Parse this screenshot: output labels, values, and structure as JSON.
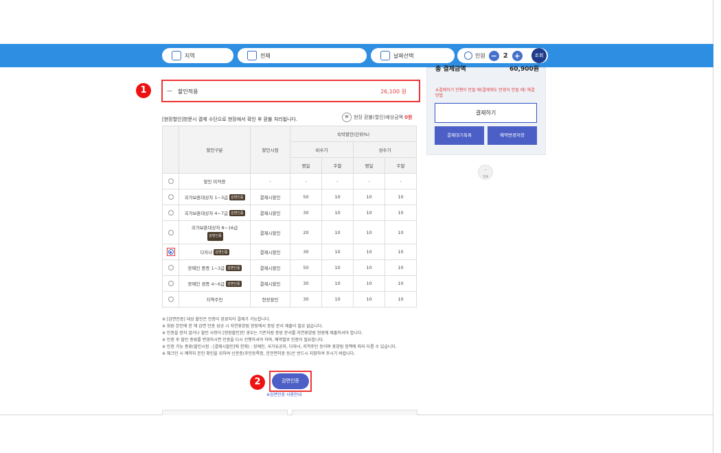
{
  "searchbar": {
    "region_label": "지역",
    "facility_label": "전체",
    "date_label": "날짜선택",
    "people_label": "인원",
    "people_count": "2",
    "minus": "−",
    "plus": "+",
    "query_label": "조회"
  },
  "discount_box": {
    "dash": "—",
    "label": "할인적용",
    "amount": "26,100 원"
  },
  "badges": {
    "one": "1",
    "two": "2"
  },
  "notice": "[현장할인]방문시 결제 수단으로 현장에서 확인 후 환불 처리됩니다.",
  "onsite": {
    "icon_text": "₩",
    "label": "현장 환불(할인)예상금액",
    "amount": "0원"
  },
  "table": {
    "headers": {
      "type": "할인구분",
      "time": "할인시점",
      "rate_group": "숙박할인(단위%)",
      "off_season": "비수기",
      "peak_season": "성수기",
      "weekday": "평일",
      "weekend": "주말"
    },
    "rows": [
      {
        "label": "할인 미적용",
        "tag": "",
        "time": "-",
        "v1": "-",
        "v2": "-",
        "v3": "-",
        "v4": "-",
        "selected": false
      },
      {
        "label": "국가보훈대상자 1~3급",
        "tag": "감면인증",
        "time": "결제시할인",
        "v1": "50",
        "v2": "10",
        "v3": "10",
        "v4": "10",
        "selected": false
      },
      {
        "label": "국가보훈대상자 4~7급",
        "tag": "감면인증",
        "time": "결제시할인",
        "v1": "30",
        "v2": "10",
        "v3": "10",
        "v4": "10",
        "selected": false
      },
      {
        "label": "국가보훈대상자 8~16급",
        "tag": "감면인증",
        "time": "결제시할인",
        "v1": "20",
        "v2": "10",
        "v3": "10",
        "v4": "10",
        "selected": false
      },
      {
        "label": "다자녀",
        "tag": "감면인증",
        "time": "결제시할인",
        "v1": "30",
        "v2": "10",
        "v3": "10",
        "v4": "10",
        "selected": true
      },
      {
        "label": "장애인 중증 1~3급",
        "tag": "감면인증",
        "time": "결제시할인",
        "v1": "50",
        "v2": "10",
        "v3": "10",
        "v4": "10",
        "selected": false
      },
      {
        "label": "장애인 경증 4~6급",
        "tag": "감면인증",
        "time": "결제시할인",
        "v1": "30",
        "v2": "10",
        "v3": "10",
        "v4": "10",
        "selected": false
      },
      {
        "label": "지역주민",
        "tag": "",
        "time": "현장할인",
        "v1": "30",
        "v2": "10",
        "v3": "10",
        "v4": "10",
        "selected": false
      }
    ]
  },
  "notes": [
    "※ [감면인증] 대상 할인은 인증이 완료되어 결제가 가능합니다.",
    "※ 회원 본인에 한 해 감면 인증 성공 시 자연휴양림 현장에서 증빙 문서 제출이 필요 없습니다.",
    "※ 인증을 받지 않거나 할인 사항이 [현장할인]인 경우는 기존처럼 증빙 문서를 자연휴양림 현장에 제출하셔야 합니다.",
    "※ 인증 후 할인 종류를 변경하시면 인증을 다시 진행하셔야 하며, 예약별로 인증이 필요합니다.",
    "※ 인증 가능 종류(할인시점 : [결제시할인]에 한해) : 장애인, 국가유공자, 다자녀, 지역주민 등이며 휴양림 정책에 따라 다름 수 있습니다.",
    "※ 체크인 시 예약자 본인 확인을 위하여 신분증(주민등록증, 운전면허증 등)은 반드시 지참하여 주시기 바랍니다."
  ],
  "cert": {
    "button": "감면인증",
    "guide": "※감면인증 사용안내"
  },
  "right_panel": {
    "total_label": "총 결제금액",
    "total_value": "60,900원",
    "warning": "※결제하기 진행이 안될 때(결제해도 반영이 안될 때) 해결 방법",
    "pay_button": "결제하기",
    "wait_button": "결제대기목록",
    "cancel_button": "예약변경저장"
  },
  "top_button": "TOP",
  "colors": {
    "bar": "#2d8ee2",
    "accent": "#4b5fc6",
    "alert": "#e33333"
  }
}
